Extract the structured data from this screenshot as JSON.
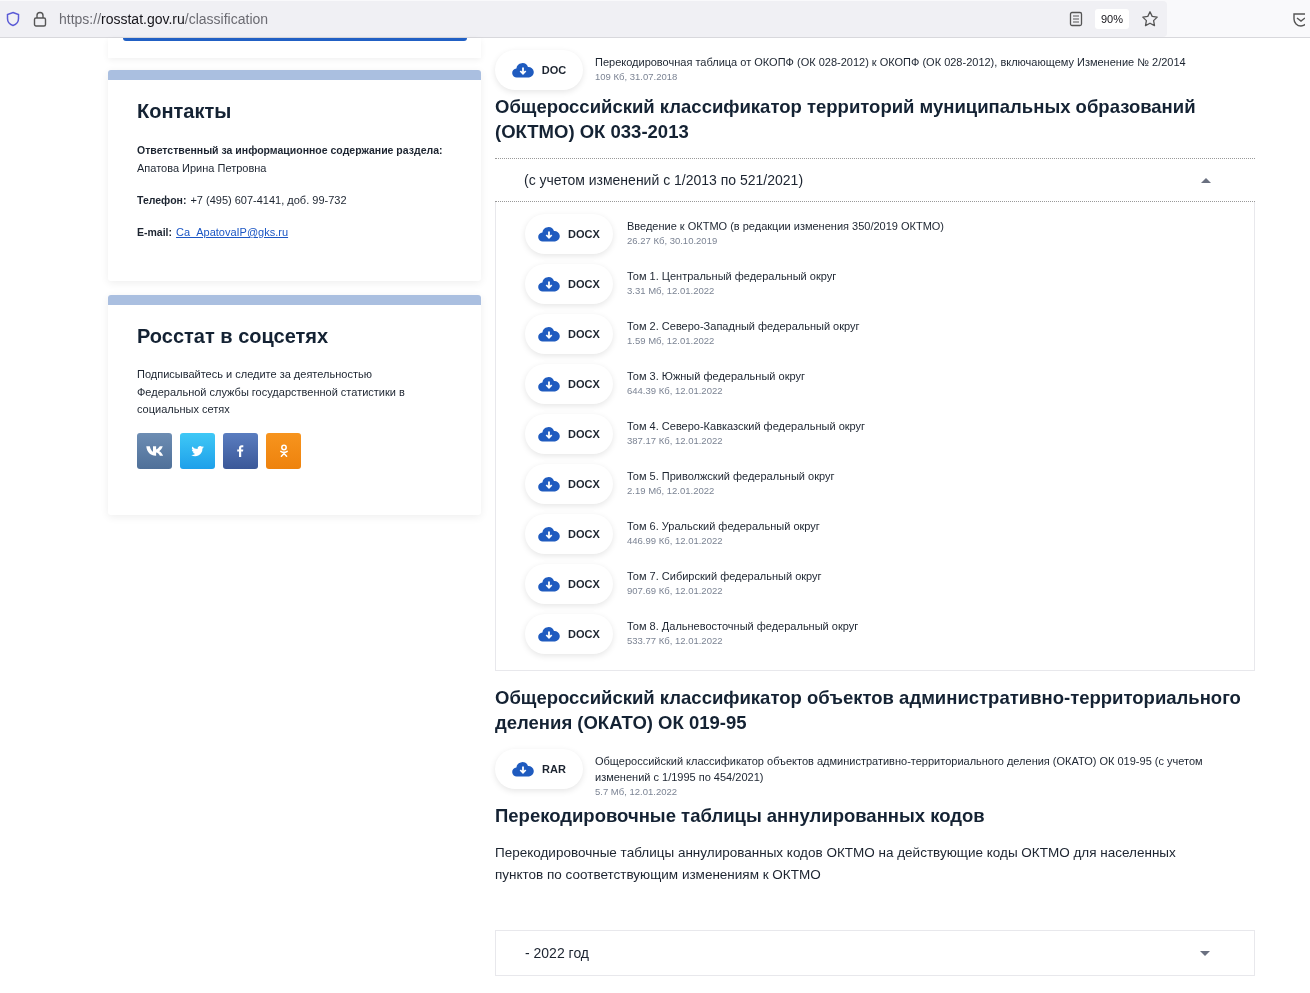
{
  "browser": {
    "url_scheme": "https://",
    "url_host": "rosstat.gov.ru",
    "url_path": "/classification",
    "zoom": "90%"
  },
  "sidebar": {
    "contacts": {
      "title": "Контакты",
      "responsible_label": "Ответственный за информационное содержание раздела:",
      "responsible_name": "Апатова Ирина Петровна",
      "phone_label": "Телефон:",
      "phone": "+7 (495) 607-4141, доб. 99-732",
      "email_label": "E-mail:",
      "email": "Ca_ApatovaIP@gks.ru"
    },
    "social": {
      "title": "Росстат в соцсетях",
      "text": "Подписывайтесь и следите за деятельностью Федеральной службы государственной статистики в социальных сетях",
      "networks": [
        {
          "kind": "vk"
        },
        {
          "kind": "twitter"
        },
        {
          "kind": "facebook"
        },
        {
          "kind": "ok"
        }
      ]
    }
  },
  "main": [
    {
      "kind": "file",
      "format": "DOC",
      "title": "Перекодировочная таблица от ОКОПФ (ОК 028-2012) к ОКОПФ (ОК 028-2012), включающему Изменение № 2/2014",
      "meta": "109 Кб, 31.07.2018"
    },
    {
      "kind": "heading",
      "text": "Общероссийский классификатор территорий муниципальных образований (ОКТМО) ОК 033-2013"
    },
    {
      "kind": "accordion",
      "label": "(с учетом изменений с 1/2013 по 521/2021)",
      "expanded": true,
      "files": [
        {
          "format": "DOCX",
          "title": "Введение к ОКТМО (в редакции изменения 350/2019 ОКТМО)",
          "meta": "26.27 Кб, 30.10.2019"
        },
        {
          "format": "DOCX",
          "title": "Том 1. Центральный федеральный округ",
          "meta": "3.31 Мб, 12.01.2022"
        },
        {
          "format": "DOCX",
          "title": "Том 2. Северо-Западный федеральный округ",
          "meta": "1.59 Мб, 12.01.2022"
        },
        {
          "format": "DOCX",
          "title": "Том 3. Южный федеральный округ",
          "meta": "644.39 Кб, 12.01.2022"
        },
        {
          "format": "DOCX",
          "title": "Том 4. Северо-Кавказский федеральный округ",
          "meta": "387.17 Кб, 12.01.2022"
        },
        {
          "format": "DOCX",
          "title": "Том 5. Приволжский федеральный округ",
          "meta": "2.19 Мб, 12.01.2022"
        },
        {
          "format": "DOCX",
          "title": "Том 6. Уральский федеральный округ",
          "meta": "446.99 Кб, 12.01.2022"
        },
        {
          "format": "DOCX",
          "title": "Том 7. Сибирский федеральный округ",
          "meta": "907.69 Кб, 12.01.2022"
        },
        {
          "format": "DOCX",
          "title": "Том 8. Дальневосточный федеральный округ",
          "meta": "533.77 Кб, 12.01.2022"
        }
      ]
    },
    {
      "kind": "heading",
      "text": "Общероссийский классификатор объектов административно-территориального деления (ОКАТО) ОК 019-95"
    },
    {
      "kind": "file",
      "format": "RAR",
      "title": "Общероссийский классификатор объектов административно-территориального деления (ОКАТО) ОК 019-95 (с учетом изменений с 1/1995 по 454/2021)",
      "meta": "5.7 Мб, 12.01.2022"
    },
    {
      "kind": "heading",
      "text": "Перекодировочные таблицы аннулированных кодов"
    },
    {
      "kind": "paragraph",
      "text": "Перекодировочные таблицы аннулированных кодов ОКТМО на действующие коды ОКТМО для населенных пунктов по соответствующим изменениям к ОКТМО"
    },
    {
      "kind": "accordion",
      "label": "- 2022 год",
      "expanded": false
    }
  ]
}
